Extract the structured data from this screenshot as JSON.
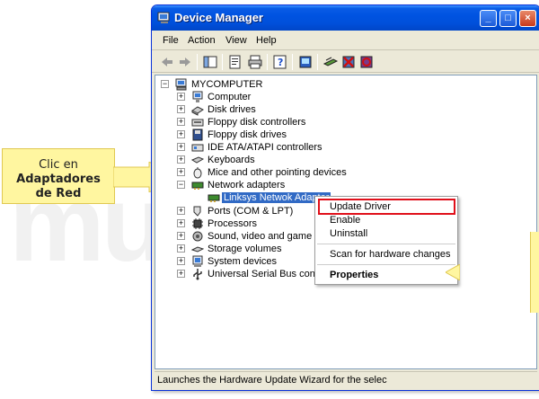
{
  "window": {
    "title": "Device Manager"
  },
  "titlebar_buttons": {
    "minimize": "_",
    "maximize": "□",
    "close": "×"
  },
  "menubar": [
    "File",
    "Action",
    "View",
    "Help"
  ],
  "tree": {
    "root": "MYCOMPUTER",
    "items": [
      {
        "label": "Computer",
        "icon": "computer-icon"
      },
      {
        "label": "Disk drives",
        "icon": "disk-drive-icon"
      },
      {
        "label": "Floppy disk controllers",
        "icon": "floppy-controller-icon"
      },
      {
        "label": "Floppy disk drives",
        "icon": "floppy-drive-icon"
      },
      {
        "label": "IDE ATA/ATAPI controllers",
        "icon": "ide-controller-icon"
      },
      {
        "label": "Keyboards",
        "icon": "keyboard-icon"
      },
      {
        "label": "Mice and other pointing devices",
        "icon": "mouse-icon"
      },
      {
        "label": "Network adapters",
        "icon": "network-adapter-icon",
        "expanded": true
      },
      {
        "label": "Linksys Netwok Adapter",
        "icon": "network-card-icon",
        "child": true,
        "selected": true
      },
      {
        "label": "Ports (COM & LPT)",
        "icon": "port-icon"
      },
      {
        "label": "Processors",
        "icon": "processor-icon"
      },
      {
        "label": "Sound, video and game cont",
        "icon": "sound-icon"
      },
      {
        "label": "Storage volumes",
        "icon": "storage-icon"
      },
      {
        "label": "System devices",
        "icon": "system-device-icon"
      },
      {
        "label": "Universal Serial Bus controlle",
        "icon": "usb-icon"
      }
    ]
  },
  "context_menu": {
    "items": [
      "Update Driver",
      "Enable",
      "Uninstall",
      "Scan for hardware changes",
      "Properties"
    ]
  },
  "status_bar": "Launches the Hardware Update Wizard for the selec",
  "callout": {
    "line1": "Clic en",
    "line2": "Adaptadores",
    "line3": "de Red"
  },
  "colors": {
    "selection": "#316ac5",
    "highlight_box": "#e0101a",
    "callout_bg": "#fff6a0",
    "titlebar": "#0053e1"
  }
}
